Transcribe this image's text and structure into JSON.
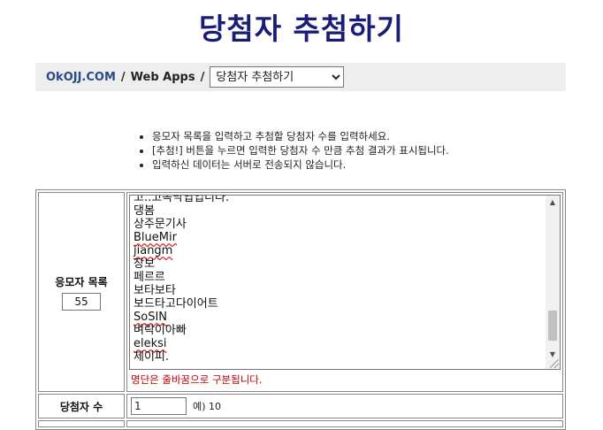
{
  "page": {
    "title": "당첨자 추첨하기"
  },
  "breadcrumb": {
    "site": "OkOJJ.COM",
    "section": "Web Apps",
    "separator": "/",
    "selected_app": "당첨자 추첨하기"
  },
  "instructions": [
    "응모자 목록을 입력하고 추첨할 당첨자 수를 입력하세요.",
    "[추첨!] 버튼을 누르면 입력한 당첨자 수 만큼 추첨 결과가 표시됩니다.",
    "입력하신 데이터는 서버로 전송되지 않습니다."
  ],
  "form": {
    "applicants": {
      "label": "응모자 목록",
      "count": "55",
      "entries": [
        "고..고속낙엽입니다.",
        "댕봄",
        "상주문기사",
        "BlueMir",
        "jiangm",
        "장보",
        "페르르",
        "보타보타",
        "보드타고다이어트",
        "SoSIN",
        "벼락이아빠",
        "eleksi",
        "제이피."
      ],
      "hint": "명단은 줄바꿈으로 구분됩니다."
    },
    "winners": {
      "label": "당첨자 수",
      "value": "1",
      "example": "예) 10"
    }
  },
  "scrollbar": {
    "up_icon": "▲",
    "down_icon": "▼"
  },
  "colors": {
    "title": "#1a1c7a",
    "hint": "#c00000",
    "link": "#2a4a8a"
  }
}
